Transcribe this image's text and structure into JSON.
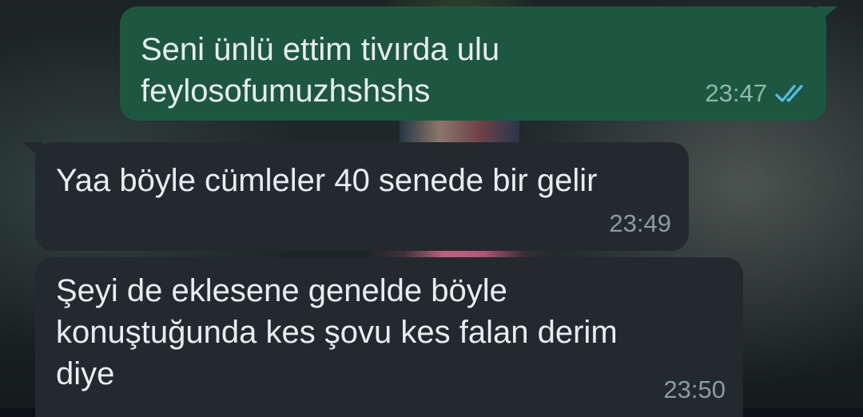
{
  "messages": [
    {
      "direction": "outgoing",
      "text": "Seni ünlü ettim tivırda ulu\nfeylosofumuzhshshs",
      "time": "23:47",
      "status": "read",
      "status_icon": "double-check-icon",
      "status_color": "#53bdeb"
    },
    {
      "direction": "incoming",
      "text": "Yaa böyle cümleler 40 senede bir gelir",
      "time": "23:49"
    },
    {
      "direction": "incoming",
      "text": "Şeyi de eklesene genelde böyle\nkonuştuğunda kes şovu kes falan derim\ndiye",
      "time": "23:50"
    }
  ],
  "colors": {
    "outgoing_bubble": "#1d5742",
    "incoming_bubble": "#222a2e",
    "text": "#e9edef",
    "time": "#8a9ba2"
  }
}
